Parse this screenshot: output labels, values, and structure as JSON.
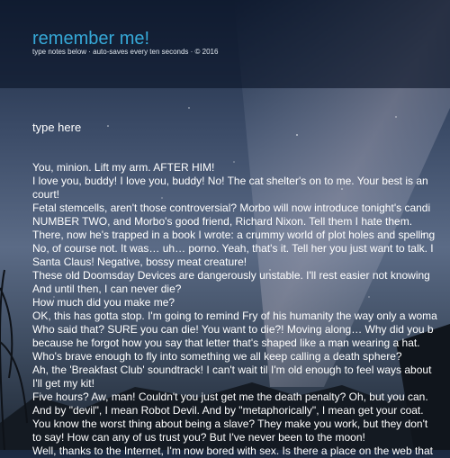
{
  "app": {
    "title": "remember me!",
    "subtitle": "type notes below · auto-saves every ten seconds · © 2016"
  },
  "editor": {
    "placeholder": "type here",
    "lines": [
      "You, minion. Lift my arm. AFTER HIM!",
      "I love you, buddy! I love you, buddy! No! The cat shelter's on to me. Your best is an",
      "court!",
      "Fetal stemcells, aren't those controversial? Morbo will now introduce tonight's candi",
      "NUMBER TWO, and Morbo's good friend, Richard Nixon. Tell them I hate them.",
      "There, now he's trapped in a book I wrote: a crummy world of plot holes and spelling",
      "No, of course not. It was… uh… porno. Yeah, that's it. Tell her you just want to talk. I",
      "Santa Claus! Negative, bossy meat creature!",
      "These old Doomsday Devices are dangerously unstable. I'll rest easier not knowing",
      "And until then, I can never die?",
      "How much did you make me?",
      "OK, this has gotta stop. I'm going to remind Fry of his humanity the way only a woma",
      "Who said that? SURE you can die! You want to die?! Moving along… Why did you b",
      "because he forgot how you say that letter that's shaped like a man wearing a hat.",
      "Who's brave enough to fly into something we all keep calling a death sphere?",
      "Ah, the 'Breakfast Club' soundtrack! I can't wait til I'm old enough to feel ways about",
      "I'll get my kit!",
      "Five hours? Aw, man! Couldn't you just get me the death penalty? Oh, but you can.",
      "And by \"devil\", I mean Robot Devil. And by \"metaphorically\", I mean get your coat.",
      "You know the worst thing about being a slave? They make you work, but they don't",
      "to say! How can any of us trust you? But I've never been to the moon!",
      "Well, thanks to the Internet, I'm now bored with sex. Is there a place on the web that"
    ]
  }
}
